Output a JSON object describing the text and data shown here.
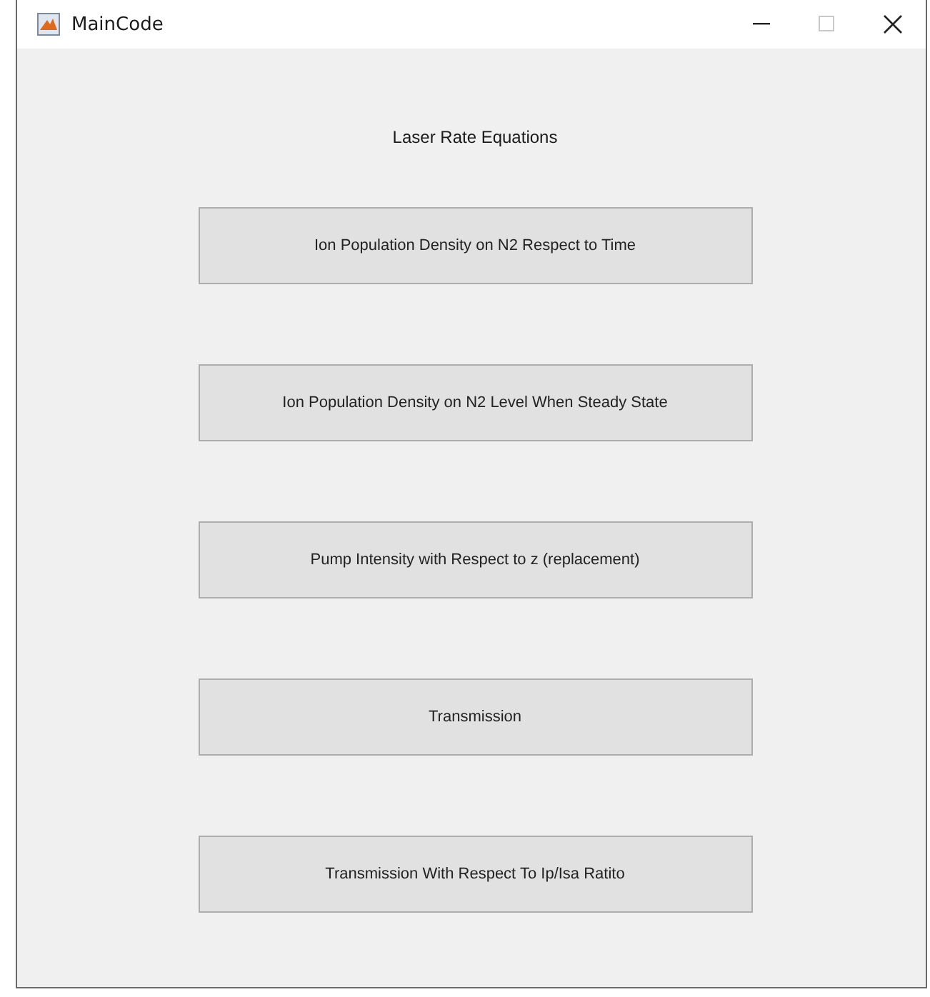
{
  "window": {
    "title": "MainCode"
  },
  "heading": "Laser Rate Equations",
  "buttons": [
    {
      "label": "Ion Population Density on N2 Respect to Time"
    },
    {
      "label": "Ion Population Density on N2 Level When Steady State"
    },
    {
      "label": "Pump Intensity with Respect to z (replacement)"
    },
    {
      "label": "Transmission"
    },
    {
      "label": "Transmission With Respect To Ip/Isa Ratito"
    }
  ]
}
